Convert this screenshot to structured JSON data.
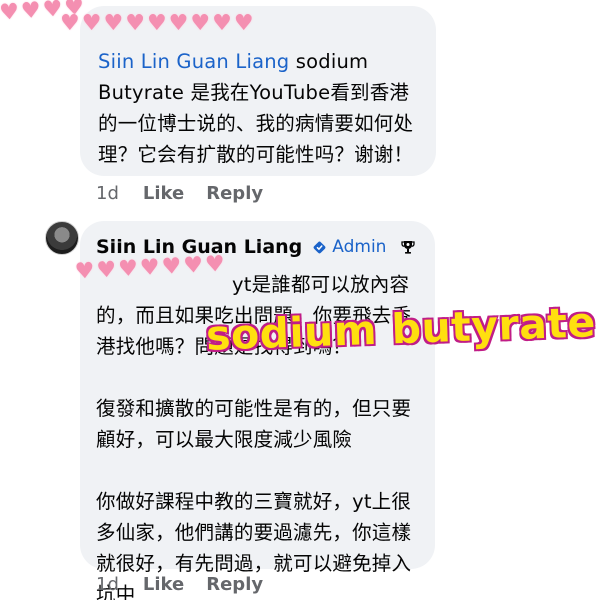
{
  "comment1": {
    "mention": "Siin Lin Guan Liang",
    "text": " sodium Butyrate 是我在YouTube看到香港的一位博士说的、我的病情要如何处理？它会有扩散的可能性吗？谢谢！",
    "time": "1d",
    "like_label": "Like",
    "reply_label": "Reply"
  },
  "comment2": {
    "author": "Siin Lin Guan Liang",
    "badge_label": "Admin",
    "paragraph1": "yt是誰都可以放內容的，而且如果吃出問題，你要飛去香港找他嗎？問題是找得到嗎？",
    "paragraph2": "復發和擴散的可能性是有的，但只要顧好，可以最大限度減少風險",
    "paragraph3": "你做好課程中教的三寶就好，yt上很多仙家，他們講的要過濾先，你這樣就很好，有先問過，就可以避免掉入坑中",
    "time": "1d",
    "like_label": "Like",
    "reply_label": "Reply"
  },
  "overlay_caption": "sodium butyrate",
  "colors": {
    "bubble": "#f0f2f5",
    "link": "#1b63c9",
    "meta": "#65676b",
    "overlay_fill": "#ffdf0f",
    "overlay_stroke": "#c01d87",
    "hearts": "#f48fb1"
  },
  "icons": {
    "admin": "shield-icon",
    "trophy": "trophy-icon",
    "redaction": "heart-icon"
  }
}
